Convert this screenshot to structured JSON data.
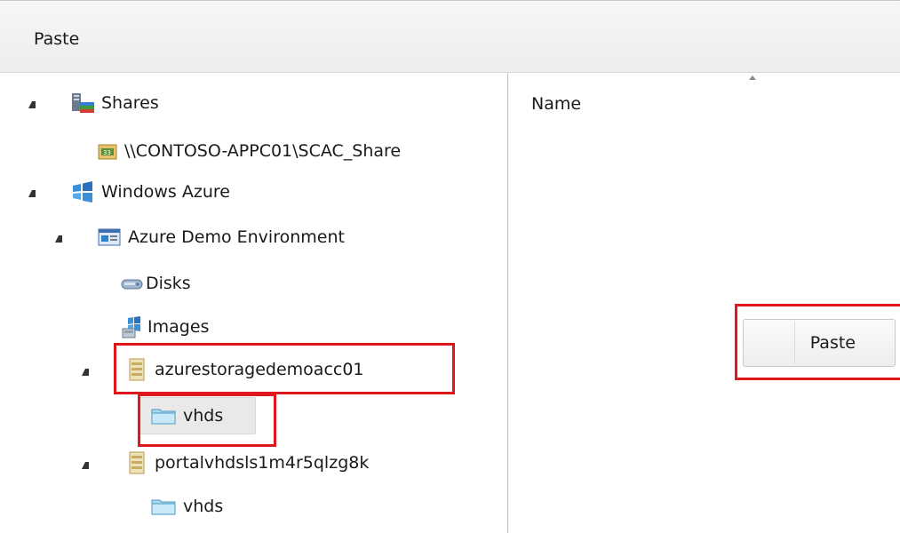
{
  "toolbar": {
    "paste_label": "Paste"
  },
  "tree": {
    "shares": "Shares",
    "share_path": "\\\\CONTOSO-APPC01\\SCAC_Share",
    "windows_azure": "Windows Azure",
    "azure_demo_env": "Azure Demo Environment",
    "disks": "Disks",
    "images": "Images",
    "storage1": "azurestoragedemoacc01",
    "storage1_vhds": "vhds",
    "storage2": "portalvhdsls1m4r5qlzg8k",
    "storage2_vhds": "vhds"
  },
  "list": {
    "name_header": "Name"
  },
  "context_menu": {
    "paste_label": "Paste"
  },
  "colors": {
    "highlight": "#e0181b"
  }
}
